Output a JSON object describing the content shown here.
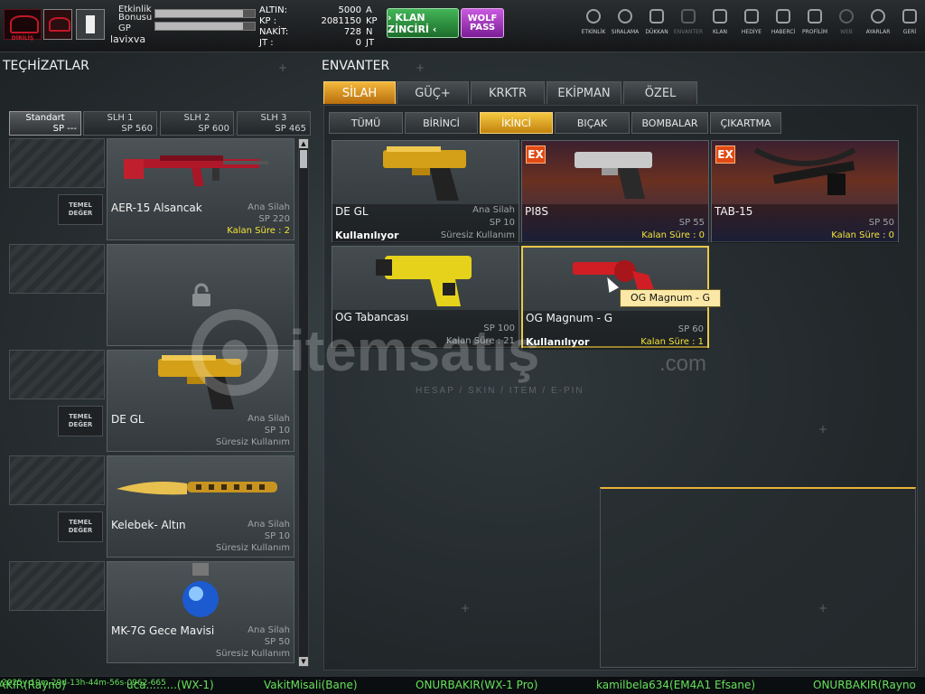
{
  "header": {
    "logo_text": "DİRİLİŞ",
    "bonus_label_1": "Etkinlik",
    "bonus_label_2": "Bonusu",
    "bonus_fill": 0.88,
    "gp_label": "GP",
    "gp_fill": 0.88,
    "username": "lavixva",
    "currencies": [
      {
        "label": "ALTIN:",
        "value": "5000",
        "unit": "A"
      },
      {
        "label": "KP :",
        "value": "2081150",
        "unit": "KP"
      },
      {
        "label": "NAKİT:",
        "value": "728",
        "unit": "N"
      },
      {
        "label": "JT :",
        "value": "0",
        "unit": "JT"
      }
    ],
    "clan_chain_label": "› KLAN ZİNCİRİ ‹",
    "wolf_pass_line1": "WOLF",
    "wolf_pass_line2": "PASS",
    "nav": [
      {
        "label": "ETKİNLİK",
        "icon": "stopwatch-icon",
        "enabled": true
      },
      {
        "label": "SIRALAMA",
        "icon": "medal-icon",
        "enabled": true
      },
      {
        "label": "DÜKKAN",
        "icon": "cart-icon",
        "enabled": true
      },
      {
        "label": "ENVANTER",
        "icon": "inventory-icon",
        "enabled": false
      },
      {
        "label": "KLAN",
        "icon": "shield-icon",
        "enabled": true
      },
      {
        "label": "HEDİYE",
        "icon": "gift-icon",
        "enabled": true
      },
      {
        "label": "HABERCİ",
        "icon": "megaphone-icon",
        "enabled": true
      },
      {
        "label": "PROFİLİM",
        "icon": "profile-icon",
        "enabled": true
      },
      {
        "label": "WEB",
        "icon": "globe-icon",
        "enabled": false
      },
      {
        "label": "AYARLAR",
        "icon": "gear-icon",
        "enabled": true
      },
      {
        "label": "GERİ",
        "icon": "back-icon",
        "enabled": true
      }
    ]
  },
  "equipment": {
    "title": "TEÇHİZATLAR",
    "loadouts": [
      {
        "name": "Standart",
        "sp": "SP ---",
        "selected": true
      },
      {
        "name": "SLH 1",
        "sp": "SP 560",
        "selected": false
      },
      {
        "name": "SLH 2",
        "sp": "SP 600",
        "selected": false
      },
      {
        "name": "SLH 3",
        "sp": "SP 465",
        "selected": false
      }
    ],
    "temel_line1": "TEMEL",
    "temel_line2": "DEĞER",
    "slots": [
      {
        "name": "AER-15 Alsancak",
        "type": "Ana Silah",
        "sp": "SP 220",
        "time": "Kalan Süre : 2",
        "time_highlight": true,
        "temel": true,
        "locked": false
      },
      {
        "name": "",
        "type": "",
        "sp": "",
        "time": "",
        "time_highlight": false,
        "temel": false,
        "locked": true
      },
      {
        "name": "DE GL",
        "type": "Ana Silah",
        "sp": "SP 10",
        "time": "Süresiz Kullanım",
        "time_highlight": false,
        "temel": true,
        "locked": false
      },
      {
        "name": "Kelebek- Altın",
        "type": "Ana Silah",
        "sp": "SP 10",
        "time": "Süresiz Kullanım",
        "time_highlight": false,
        "temel": true,
        "locked": false
      },
      {
        "name": "MK-7G Gece Mavisi",
        "type": "Ana Silah",
        "sp": "SP 50",
        "time": "Süresiz Kullanım",
        "time_highlight": false,
        "temel": false,
        "locked": false
      }
    ]
  },
  "inventory": {
    "title": "ENVANTER",
    "categories": [
      "SİLAH",
      "GÜÇ+",
      "KRKTR",
      "EKİPMAN",
      "ÖZEL"
    ],
    "selected_category": 0,
    "subcategories": [
      "TÜMÜ",
      "BİRİNCİ",
      "İKİNCİ",
      "BIÇAK",
      "BOMBALAR",
      "ÇIKARTMA"
    ],
    "selected_subcategory": 2,
    "ex_badge": "EX",
    "items": [
      {
        "name": "DE GL",
        "type": "Ana Silah",
        "sp": "SP 10",
        "time": "Süresiz Kullanım",
        "time_highlight": false,
        "in_use": "Kullanılıyor",
        "ex": false,
        "highlight": false
      },
      {
        "name": "PI8S",
        "type": "",
        "sp": "SP 55",
        "time": "Kalan Süre : 0",
        "time_highlight": true,
        "in_use": "",
        "ex": true,
        "highlight": false
      },
      {
        "name": "TAB-15",
        "type": "",
        "sp": "SP 50",
        "time": "Kalan Süre : 0",
        "time_highlight": true,
        "in_use": "",
        "ex": true,
        "highlight": false
      },
      {
        "name": "OG Tabancası",
        "type": "",
        "sp": "SP 100",
        "time": "Kalan Süre : 21",
        "time_highlight": false,
        "in_use": "",
        "ex": false,
        "highlight": false
      },
      {
        "name": "OG Magnum - G",
        "type": "",
        "sp": "SP 60",
        "time": "Kalan Süre : 1",
        "time_highlight": true,
        "in_use": "Kullanılıyor",
        "ex": false,
        "highlight": true
      }
    ],
    "tooltip": "OG Magnum - G"
  },
  "watermark": {
    "brand": "itemsatış",
    "domain": ".com",
    "tagline": "HESAP / SKIN / ITEM / E-PIN"
  },
  "ticker": {
    "timestamp": "2025y-10m-29d-13h-44m-56s-0962-665",
    "messages": [
      "AKIR(Rayno)",
      "uca.........(WX-1)",
      "VakitMisali(Bane)",
      "ONURBAKIR(WX-1 Pro)",
      "kamilbela634(EM4A1 Efsane)",
      "ONURBAKIR(Rayno"
    ]
  }
}
